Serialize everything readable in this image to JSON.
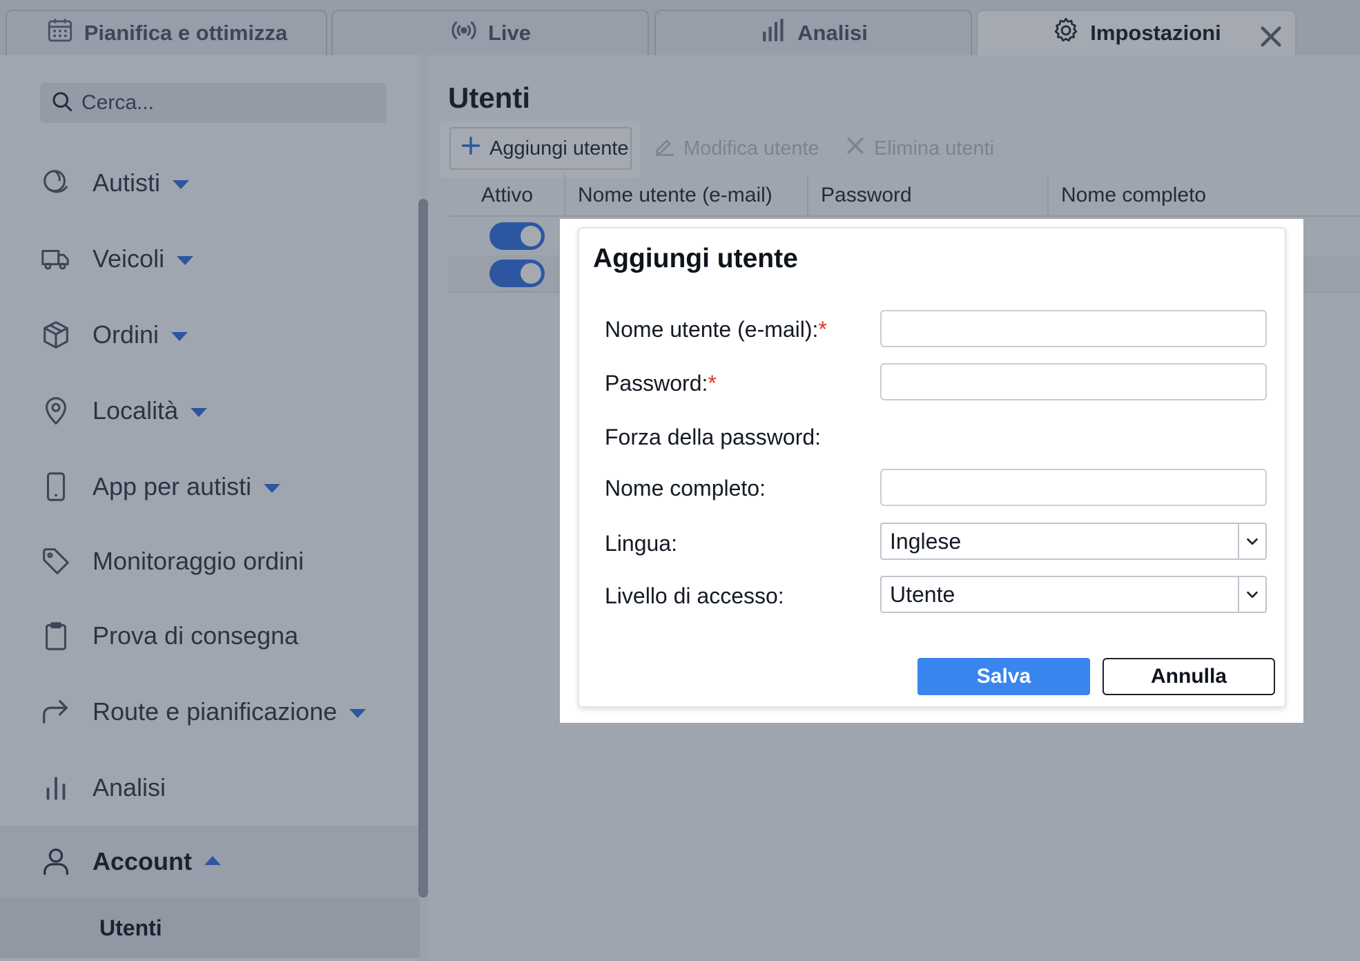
{
  "tabs": [
    {
      "label": "Pianifica e ottimizza",
      "icon": "calendar-icon"
    },
    {
      "label": "Live",
      "icon": "broadcast-icon"
    },
    {
      "label": "Analisi",
      "icon": "bar-chart-icon"
    },
    {
      "label": "Impostazioni",
      "icon": "gear-icon",
      "active": true
    }
  ],
  "sidebar": {
    "search_placeholder": "Cerca...",
    "items": [
      {
        "label": "Autisti",
        "icon": "driver-icon",
        "expandable": true
      },
      {
        "label": "Veicoli",
        "icon": "truck-icon",
        "expandable": true
      },
      {
        "label": "Ordini",
        "icon": "package-icon",
        "expandable": true
      },
      {
        "label": "Località",
        "icon": "map-pin-icon",
        "expandable": true
      },
      {
        "label": "App per autisti",
        "icon": "mobile-phone-icon",
        "expandable": true
      },
      {
        "label": "Monitoraggio ordini",
        "icon": "tag-icon",
        "expandable": false
      },
      {
        "label": "Prova di consegna",
        "icon": "clipboard-icon",
        "expandable": false
      },
      {
        "label": "Route e pianificazione",
        "icon": "share-arrow-icon",
        "expandable": true
      },
      {
        "label": "Analisi",
        "icon": "bar-chart-icon",
        "expandable": false
      },
      {
        "label": "Account",
        "icon": "user-icon",
        "expanded": true
      }
    ],
    "sub_items": [
      {
        "label": "Utenti",
        "selected": true
      }
    ]
  },
  "main": {
    "title": "Utenti",
    "toolbar": {
      "add_label": "Aggiungi utente",
      "edit_label": "Modifica utente",
      "delete_label": "Elimina utenti"
    },
    "table": {
      "columns": [
        "Attivo",
        "Nome utente (e-mail)",
        "Password",
        "Nome completo"
      ],
      "rows": [
        {
          "active": true
        },
        {
          "active": true
        }
      ]
    }
  },
  "modal": {
    "title": "Aggiungi utente",
    "fields": {
      "username_label": "Nome utente (e-mail):",
      "password_label": "Password:",
      "strength_label": "Forza della password:",
      "fullname_label": "Nome completo:",
      "language_label": "Lingua:",
      "language_value": "Inglese",
      "access_label": "Livello di accesso:",
      "access_value": "Utente",
      "required_marker": "*"
    },
    "save_label": "Salva",
    "cancel_label": "Annulla"
  },
  "colors": {
    "accent": "#2f6fe0",
    "primary_button": "#3a85ee",
    "required": "#e03324",
    "overlay": "rgba(40,52,72,0.42)"
  }
}
